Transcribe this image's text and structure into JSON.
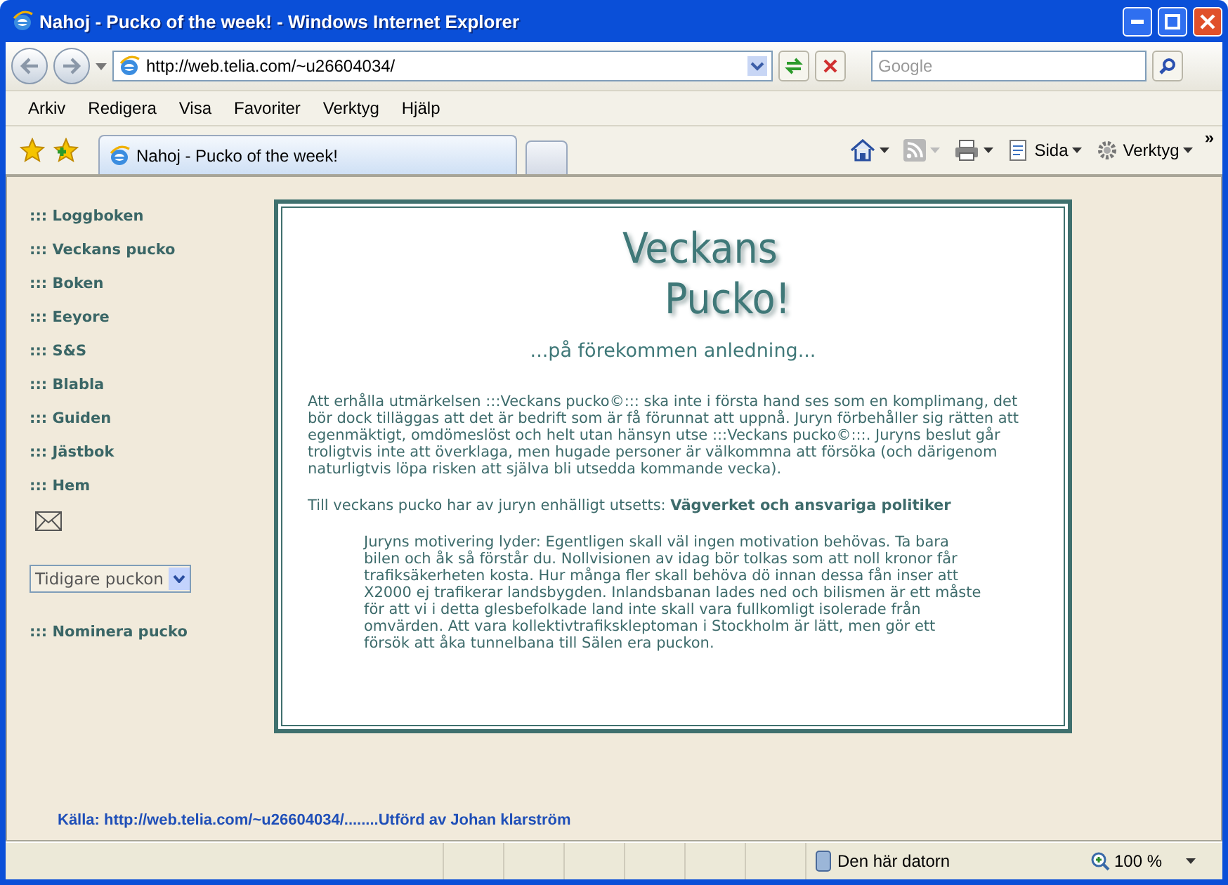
{
  "window": {
    "title": "Nahoj - Pucko of the week! - Windows Internet Explorer"
  },
  "address_bar": {
    "url": "http://web.telia.com/~u26604034/"
  },
  "search": {
    "placeholder": "Google"
  },
  "menu_bar": [
    "Arkiv",
    "Redigera",
    "Visa",
    "Favoriter",
    "Verktyg",
    "Hjälp"
  ],
  "tabs": [
    {
      "label": "Nahoj - Pucko of the week!",
      "selected": true
    }
  ],
  "command_bar": {
    "buttons": [
      "Sida",
      "Verktyg"
    ],
    "overflow": "»"
  },
  "sidebar": {
    "links": [
      "::: Loggboken",
      "::: Veckans pucko",
      "::: Boken",
      "::: Eeyore",
      "::: S&S",
      "::: Blabla",
      "::: Guiden",
      "::: Jästbok",
      "::: Hem"
    ],
    "dropdown": "Tidigare puckon",
    "bottom_link": "::: Nominera pucko"
  },
  "article": {
    "title_lines": [
      "Veckans",
      "Pucko!"
    ],
    "subtitle": "...på förekommen anledning...",
    "paragraphs": [
      "Att erhålla utmärkelsen :::Veckans pucko©::: ska inte i första hand ses som en komplimang, det bör dock tilläggas att det är bedrift som är få förunnat att uppnå. Juryn förbehåller sig rätten att egenmäktigt, omdömeslöst och helt utan hänsyn utse :::Veckans pucko©:::. Juryns beslut går troligtvis inte att överklaga, men hugade personer är välkommna att försöka (och därigenom naturligtvis löpa risken att själva bli utsedda kommande vecka).",
      "Till veckans pucko har av juryn enhälligt utsetts: **Vägverket och ansvariga politiker**"
    ],
    "quote": "Juryns motivering lyder: Egentligen skall väl ingen motivation behövas. Ta bara bilen och åk så förstår du. Nollvisionen av idag bör tolkas som att noll kronor får trafiksäkerheten kosta. Hur många fler skall behöva dö innan dessa fån inser att X2000 ej trafikerar landsbygden. Inlandsbanan lades ned och bilismen är ett måste för att vi i detta glesbefolkade land inte skall vara fullkomligt isolerade från omvärden. Att vara kollektivtrafikskleptoman i Stockholm är lätt, men gör ett försök att åka tunnelbana till Sälen era puckon."
  },
  "footer": "Källa: http://web.telia.com/~u26604034/........Utförd av Johan klarström",
  "status_bar": {
    "zone": "Den här datorn",
    "zoom": "100 %"
  }
}
